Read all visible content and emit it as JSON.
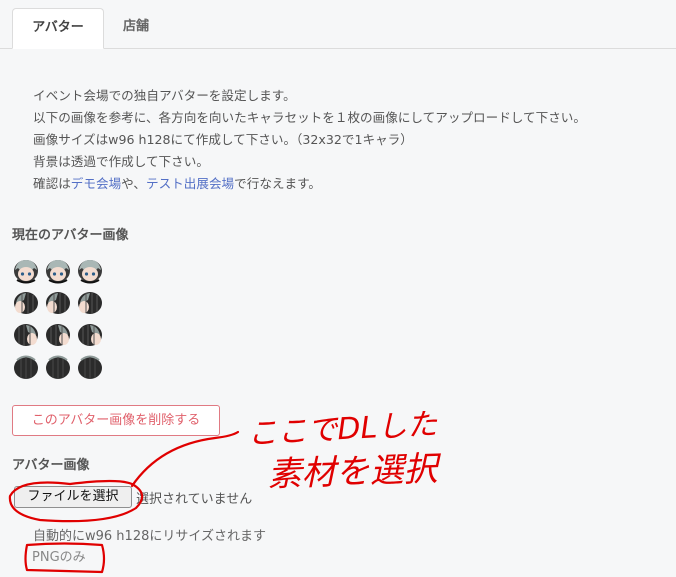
{
  "tabs": [
    {
      "label": "アバター",
      "active": true
    },
    {
      "label": "店舗",
      "active": false
    }
  ],
  "description": {
    "line1": "イベント会場での独自アバターを設定します。",
    "line2": "以下の画像を参考に、各方向を向いたキャラセットを１枚の画像にしてアップロードして下さい。",
    "line3": "画像サイズはw96 h128にて作成して下さい。（32x32で1キャラ）",
    "line4": "背景は透過で作成して下さい。",
    "line5_pre": "確認は",
    "line5_link1": "デモ会場",
    "line5_mid": "や、",
    "line5_link2": "テスト出展会場",
    "line5_post": "で行なえます。"
  },
  "current_avatar": {
    "title": "現在のアバター画像",
    "delete_label": "このアバター画像を削除する"
  },
  "upload": {
    "title": "アバター画像",
    "file_button": "ファイルを選択",
    "file_status": "選択されていません",
    "hint": "自動的にw96 h128にリサイズされます",
    "format_badge": "PNGのみ"
  },
  "annotation": {
    "line1": "ここでDLした",
    "line2": "素材を選択",
    "color": "#e00000"
  },
  "colors": {
    "link": "#5470c6",
    "danger": "#e0606b"
  }
}
